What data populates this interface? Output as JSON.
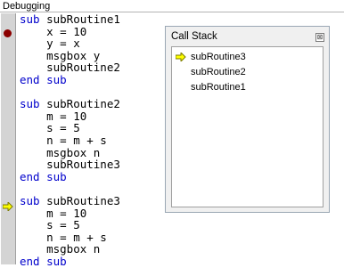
{
  "window": {
    "title": "Debugging"
  },
  "code": {
    "lines": [
      [
        "sub ",
        "subRoutine1"
      ],
      [
        "",
        "    x = 10"
      ],
      [
        "",
        "    y = x"
      ],
      [
        "",
        "    msgbox y"
      ],
      [
        "",
        "    subRoutine2"
      ],
      [
        "end sub",
        ""
      ],
      [
        "",
        ""
      ],
      [
        "sub ",
        "subRoutine2"
      ],
      [
        "",
        "    m = 10"
      ],
      [
        "",
        "    s = 5"
      ],
      [
        "",
        "    n = m + s"
      ],
      [
        "",
        "    msgbox n"
      ],
      [
        "",
        "    subRoutine3"
      ],
      [
        "end sub",
        ""
      ],
      [
        "",
        ""
      ],
      [
        "sub ",
        "subRoutine3"
      ],
      [
        "",
        "    m = 10"
      ],
      [
        "",
        "    s = 5"
      ],
      [
        "",
        "    n = m + s"
      ],
      [
        "",
        "    msgbox n"
      ],
      [
        "end sub",
        ""
      ]
    ],
    "keyword_color": "#0000cc",
    "breakpoint_color": "#8b0000",
    "pointer_color": "#ffff00"
  },
  "call_stack": {
    "title": "Call Stack",
    "close_label": "⊠",
    "frames": [
      "subRoutine3",
      "subRoutine2",
      "subRoutine1"
    ],
    "current_frame_icon": "arrow-right-icon"
  }
}
